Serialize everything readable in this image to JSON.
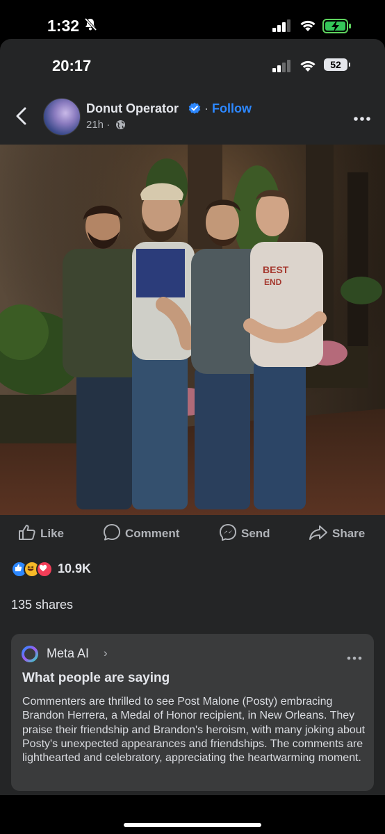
{
  "outer_status": {
    "time": "1:32"
  },
  "inner_status": {
    "time": "20:17",
    "battery": "52"
  },
  "post": {
    "author": "Donut Operator",
    "separator": "·",
    "follow_label": "Follow",
    "timestamp": "21h ·"
  },
  "actions": {
    "like": "Like",
    "comment": "Comment",
    "send": "Send",
    "share": "Share"
  },
  "engagement": {
    "reaction_count": "10.9K",
    "shares": "135 shares"
  },
  "meta_ai": {
    "name": "Meta AI",
    "chevron": "›",
    "heading": "What people are saying",
    "body": "Commenters are thrilled to see Post Malone (Posty) embracing Brandon Herrera, a Medal of Honor recipient, in New Orleans. They praise their friendship and Brandon's heroism, with many joking about Posty's unexpected appearances and friendships. The comments are lighthearted and celebratory, appreciating the heartwarming moment."
  },
  "colors": {
    "background": "#242526",
    "card": "#3a3b3c",
    "accent": "#2d88ff",
    "text": "#e4e6eb",
    "secondary_text": "#b0b3b8"
  },
  "icons": [
    "bell-off-icon",
    "cell-signal-icon",
    "wifi-icon",
    "battery-charging-icon",
    "back-chevron-icon",
    "verified-badge-icon",
    "globe-icon",
    "more-icon",
    "like-icon",
    "comment-icon",
    "messenger-icon",
    "share-icon",
    "meta-ai-logo-icon"
  ]
}
